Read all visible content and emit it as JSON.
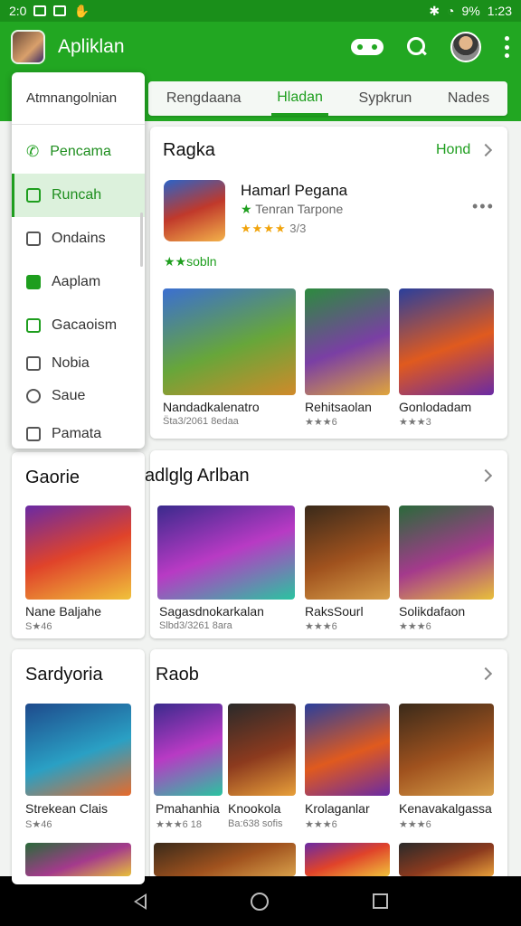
{
  "status_bar": {
    "time": "2:0",
    "battery": "9%",
    "clock_right": "1:23"
  },
  "app_bar": {
    "title": "Apliklan"
  },
  "tabs": [
    "Rengdaana",
    "Hladan",
    "Sypkrun",
    "Nades"
  ],
  "tabs_active": 1,
  "menu": {
    "header": "Atmnangolnian",
    "items": [
      "Pencama",
      "Runcah",
      "Ondains",
      "Aaplam",
      "Gacaoism",
      "Nobia",
      "Saue",
      "Pamata"
    ]
  },
  "section1": {
    "title": "Ragka",
    "more": "Hond",
    "featured": {
      "name": "Hamarl Pegana",
      "subtitle": "Tenran Tarpone",
      "stars": "★★★★",
      "rating": "3/3",
      "tagline": "★★sobln"
    },
    "games": [
      {
        "title": "Nandadkalenatro",
        "meta": "S̈ta3/2061 8edaa"
      },
      {
        "title": "Rehitsaolan",
        "meta": "★★★6"
      },
      {
        "title": "Gonlodadam",
        "meta": "★★★3"
      }
    ]
  },
  "section2": {
    "title_left": "Gaorie",
    "title_right": "adlglg Arlban",
    "games": [
      {
        "title": "Nane Baljahe",
        "meta": "S★46"
      },
      {
        "title": "Sagasdnokarkalan",
        "meta": "Slbd3/3261 8ara"
      },
      {
        "title": "RaksSourl",
        "meta": "★★★6"
      },
      {
        "title": "Solikdafaon",
        "meta": "★★★6"
      }
    ]
  },
  "section3": {
    "title_left": "Sardyoria",
    "title_right": "Raob",
    "games": [
      {
        "title": "Strekean Clais",
        "meta": "S★46"
      },
      {
        "title": "Pmahanhia",
        "meta": "★★★6 18"
      },
      {
        "title": "Knookola",
        "meta": "Ba:638 sofis"
      },
      {
        "title": "Krolaganlar",
        "meta": "★★★6"
      },
      {
        "title": "Kenavakalgassa",
        "meta": "★★★6"
      }
    ]
  },
  "colors": {
    "primary": "#22a722",
    "status_bar": "#1a8f1a",
    "accent_text": "#1e9e1e",
    "star": "#f1a30a"
  }
}
